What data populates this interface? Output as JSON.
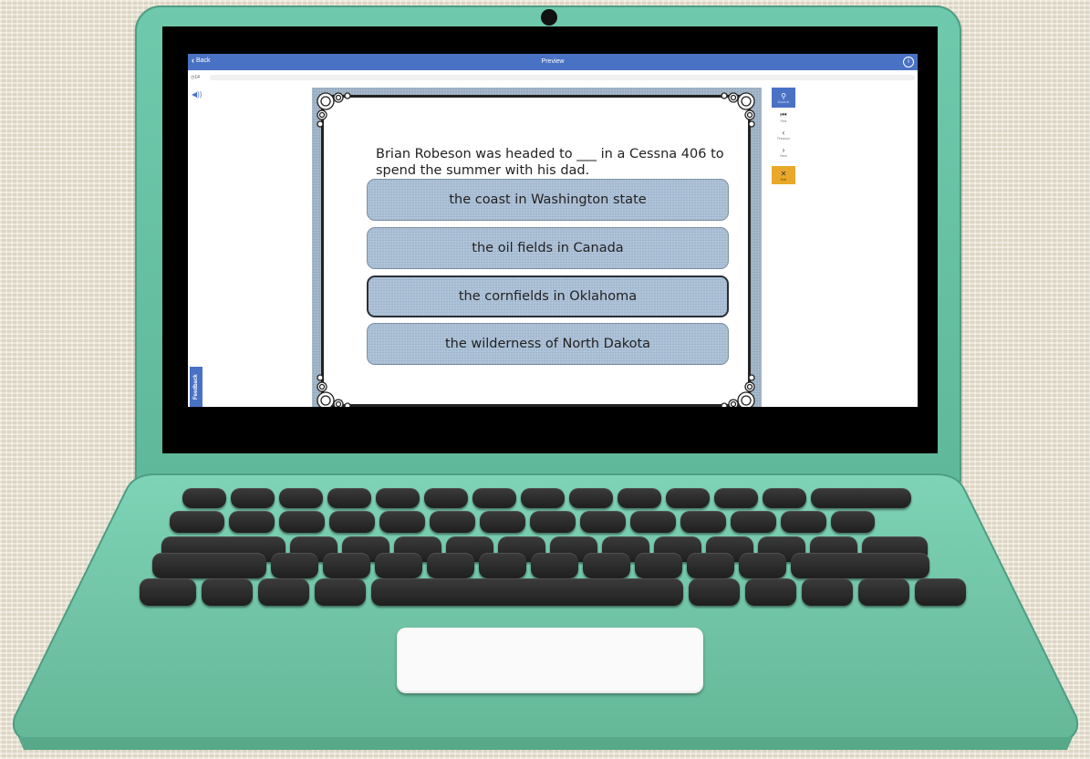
{
  "app": {
    "back_label": "Back",
    "title": "Preview",
    "progress_count": "14"
  },
  "slide": {
    "question": "Brian Robeson was headed to ___ in a Cessna 406 to spend the summer with his dad.",
    "answers": [
      {
        "label": "the coast in Washington state",
        "selected": false
      },
      {
        "label": "the oil fields in Canada",
        "selected": false
      },
      {
        "label": "the cornfields in Oklahoma",
        "selected": true
      },
      {
        "label": "the wilderness of North Dakota",
        "selected": false
      }
    ]
  },
  "tools": {
    "zoom": "Zoom in",
    "first": "First",
    "previous": "Previous",
    "next": "Next",
    "exit": "Exit"
  },
  "feedback_label": "Feedback",
  "icons": {
    "back": "chevron-left-icon",
    "info": "info-icon",
    "timer": "clock-icon",
    "audio": "speaker-icon",
    "zoom": "search-icon",
    "first": "skip-back-icon",
    "previous": "chevron-left-icon",
    "next": "chevron-right-icon",
    "exit": "close-icon"
  },
  "colors": {
    "accent": "#4a72c4",
    "exit": "#e9a82a",
    "laptop": "#6fc9ac",
    "answer": "#a9bfd6"
  }
}
